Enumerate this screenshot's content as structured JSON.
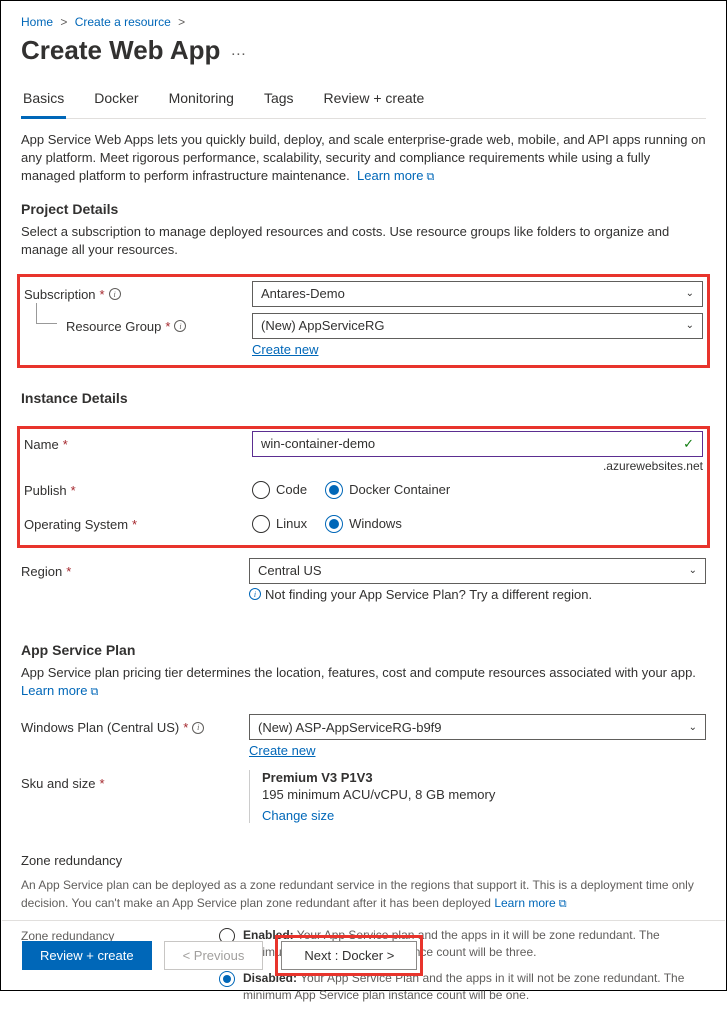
{
  "breadcrumbs": {
    "home": "Home",
    "create_resource": "Create a resource"
  },
  "title": "Create Web App",
  "tabs": {
    "basics": "Basics",
    "docker": "Docker",
    "monitoring": "Monitoring",
    "tags": "Tags",
    "review": "Review + create"
  },
  "intro": {
    "text": "App Service Web Apps lets you quickly build, deploy, and scale enterprise-grade web, mobile, and API apps running on any platform. Meet rigorous performance, scalability, security and compliance requirements while using a fully managed platform to perform infrastructure maintenance.",
    "learn_more": "Learn more"
  },
  "project_details": {
    "heading": "Project Details",
    "desc": "Select a subscription to manage deployed resources and costs. Use resource groups like folders to organize and manage all your resources.",
    "subscription_label": "Subscription",
    "subscription_value": "Antares-Demo",
    "rg_label": "Resource Group",
    "rg_value": "(New) AppServiceRG",
    "create_new": "Create new"
  },
  "instance_details": {
    "heading": "Instance Details",
    "name_label": "Name",
    "name_value": "win-container-demo",
    "suffix": ".azurewebsites.net",
    "publish_label": "Publish",
    "publish_code": "Code",
    "publish_docker": "Docker Container",
    "os_label": "Operating System",
    "os_linux": "Linux",
    "os_windows": "Windows",
    "region_label": "Region",
    "region_value": "Central US",
    "region_helper": "Not finding your App Service Plan? Try a different region."
  },
  "app_service_plan": {
    "heading": "App Service Plan",
    "desc_pre": "App Service plan pricing tier determines the location, features, cost and compute resources associated with your app.",
    "learn_more": "Learn more",
    "plan_label": "Windows Plan (Central US)",
    "plan_value": "(New) ASP-AppServiceRG-b9f9",
    "create_new": "Create new",
    "sku_label": "Sku and size",
    "sku_title": "Premium V3 P1V3",
    "sku_desc": "195 minimum ACU/vCPU, 8 GB memory",
    "change_size": "Change size"
  },
  "zone_redundancy": {
    "heading": "Zone redundancy",
    "desc_pre": "An App Service plan can be deployed as a zone redundant service in the regions that support it. This is a deployment time only decision. You can't make an App Service plan zone redundant after it has been deployed",
    "learn_more": "Learn more",
    "label": "Zone redundancy",
    "enabled_title": "Enabled:",
    "enabled_text": "Your App Service plan and the apps in it will be zone redundant. The minimum App Service plan instance count will be three.",
    "disabled_title": "Disabled:",
    "disabled_text": "Your App Service Plan and the apps in it will not be zone redundant. The minimum App Service plan instance count will be one."
  },
  "footer": {
    "review": "Review + create",
    "previous": "< Previous",
    "next": "Next : Docker >"
  }
}
